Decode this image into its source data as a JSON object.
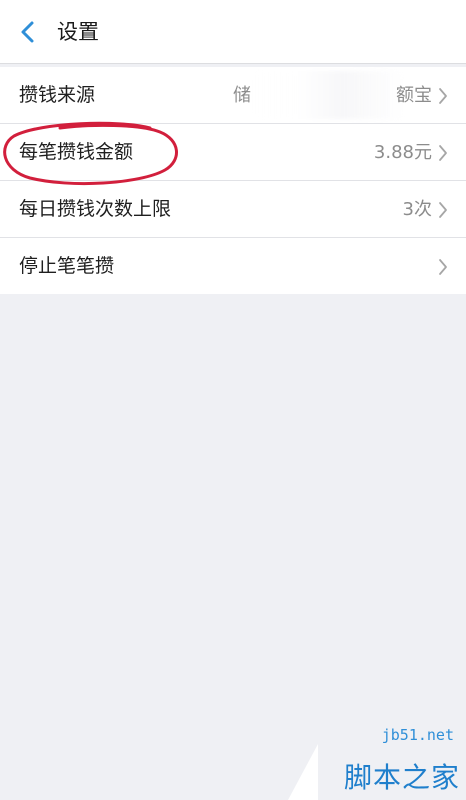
{
  "header": {
    "title": "设置"
  },
  "settings": [
    {
      "label": "攒钱来源",
      "value_left": "储",
      "value_right": "额宝"
    },
    {
      "label": "每笔攒钱金额",
      "value": "3.88元"
    },
    {
      "label": "每日攒钱次数上限",
      "value": "3次"
    },
    {
      "label": "停止笔笔攒",
      "value": ""
    }
  ],
  "watermark": {
    "url": "jb51.net",
    "text": "脚本之家"
  },
  "colors": {
    "background": "#eff0f4",
    "accent": "#2f8fd8",
    "annotation": "#d21f3c"
  }
}
